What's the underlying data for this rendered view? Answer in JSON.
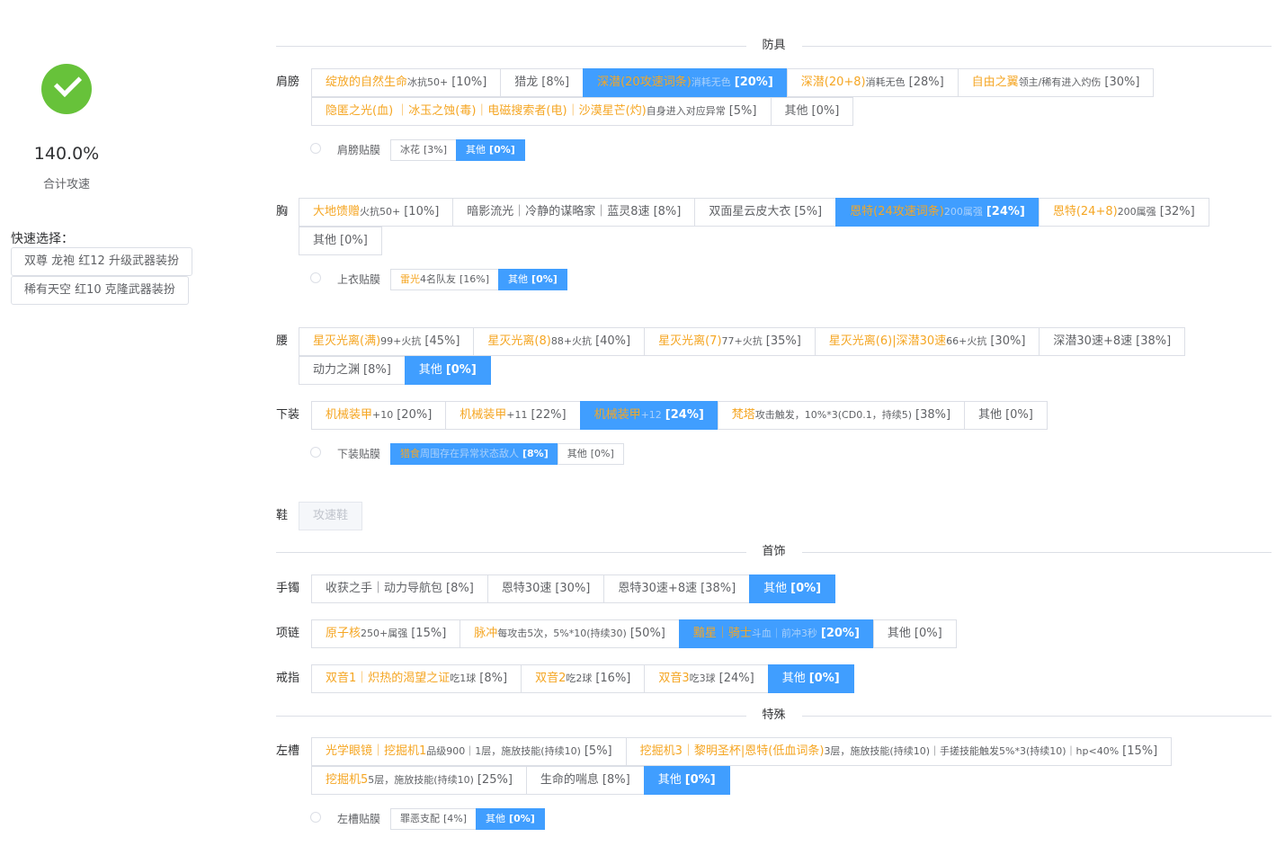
{
  "summary": {
    "total": "140.0%",
    "label": "合计攻速"
  },
  "quick": {
    "title": "快速选择：",
    "presets": [
      "双尊 龙袍 红12 升级武器装扮",
      "稀有天空 红10 克隆武器装扮"
    ]
  },
  "sections": {
    "armor": "防具",
    "accessory": "首饰",
    "special": "特殊"
  },
  "rows": {
    "shoulder": {
      "label": "肩膀",
      "options": [
        {
          "n": "绽放的自然生命",
          "d": "冰抗50+",
          "v": "[10%]"
        },
        {
          "n": "",
          "d": "",
          "t": "猎龙",
          "v": "[8%]"
        },
        {
          "n": "深潜(20攻速词条)",
          "d": "消耗无色",
          "v": "[20%]",
          "sel": true
        },
        {
          "n": "深潜(20+8)",
          "d": "消耗无色",
          "v": "[28%]"
        },
        {
          "n": "自由之翼",
          "d": "领主/稀有进入灼伤",
          "v": "[30%]"
        },
        {
          "n": "隐匿之光(血) ｜冰玉之蚀(毒)｜电磁搜索者(电)｜沙漠星芒(灼)",
          "d": "自身进入对应异常",
          "v": "[5%]"
        },
        {
          "t": "其他",
          "v": "[0%]"
        }
      ]
    },
    "shoulder_film": {
      "label": "肩膀贴膜",
      "options": [
        {
          "t": "冰花",
          "v": "[3%]"
        },
        {
          "t": "其他",
          "v": "[0%]",
          "sel": true
        }
      ]
    },
    "chest": {
      "label": "胸",
      "options": [
        {
          "n": "大地馈赠",
          "d": "火抗50+",
          "v": "[10%]"
        },
        {
          "t": "暗影流光｜冷静的谋略家｜蓝灵8速",
          "v": "[8%]"
        },
        {
          "t": "双面星云皮大衣",
          "v": "[5%]"
        },
        {
          "n": "恩特(24攻速词条)",
          "d": "200属强",
          "v": "[24%]",
          "sel": true
        },
        {
          "n": "恩特(24+8)",
          "d": "200属强",
          "v": "[32%]"
        },
        {
          "t": "其他",
          "v": "[0%]"
        }
      ]
    },
    "chest_film": {
      "label": "上衣贴膜",
      "options": [
        {
          "n": "雷光",
          "d": "4名队友",
          "v": "[16%]"
        },
        {
          "t": "其他",
          "v": "[0%]",
          "sel": true
        }
      ]
    },
    "waist": {
      "label": "腰",
      "options": [
        {
          "n": "星灭光离(满)",
          "d": "99+火抗",
          "v": "[45%]"
        },
        {
          "n": "星灭光离(8)",
          "d": "88+火抗",
          "v": "[40%]"
        },
        {
          "n": "星灭光离(7)",
          "d": "77+火抗",
          "v": "[35%]"
        },
        {
          "n": "星灭光离(6)|深潜30速",
          "d": "66+火抗",
          "v": "[30%]"
        },
        {
          "t": "深潜30速+8速",
          "v": "[38%]"
        },
        {
          "t": "动力之渊",
          "v": "[8%]"
        },
        {
          "t": "其他",
          "v": "[0%]",
          "sel": true
        }
      ]
    },
    "legs": {
      "label": "下装",
      "options": [
        {
          "n": "机械装甲",
          "d": "+10",
          "v": "[20%]"
        },
        {
          "n": "机械装甲",
          "d": "+11",
          "v": "[22%]"
        },
        {
          "n": "机械装甲",
          "d": "+12",
          "v": "[24%]",
          "sel": true
        },
        {
          "n": "梵塔",
          "d": "攻击触发，10%*3(CD0.1，持续5)",
          "v": "[38%]"
        },
        {
          "t": "其他",
          "v": "[0%]"
        }
      ]
    },
    "legs_film": {
      "label": "下装贴膜",
      "options": [
        {
          "n": "猎食",
          "d": "周围存在异常状态敌人",
          "v": "[8%]",
          "sel": true
        },
        {
          "t": "其他",
          "v": "[0%]"
        }
      ]
    },
    "shoes": {
      "label": "鞋",
      "options": [
        {
          "t": "攻速鞋",
          "dis": true
        }
      ]
    },
    "bracelet": {
      "label": "手镯",
      "options": [
        {
          "t": "收获之手｜动力导航包",
          "v": "[8%]"
        },
        {
          "t": "恩特30速",
          "v": "[30%]"
        },
        {
          "t": "恩特30速+8速",
          "v": "[38%]"
        },
        {
          "t": "其他",
          "v": "[0%]",
          "sel": true
        }
      ]
    },
    "necklace": {
      "label": "项链",
      "options": [
        {
          "n": "原子核",
          "d": "250+属强",
          "v": "[15%]"
        },
        {
          "n": "脉冲",
          "d": "每攻击5次，5%*10(持续30)",
          "v": "[50%]"
        },
        {
          "n": "黯星｜骑士",
          "d": "斗血｜前冲3秒",
          "v": "[20%]",
          "sel": true
        },
        {
          "t": "其他",
          "v": "[0%]"
        }
      ]
    },
    "ring": {
      "label": "戒指",
      "options": [
        {
          "n": "双音1｜炽热的渴望之证",
          "d": "吃1球",
          "v": "[8%]"
        },
        {
          "n": "双音2",
          "d": "吃2球",
          "v": "[16%]"
        },
        {
          "n": "双音3",
          "d": "吃3球",
          "v": "[24%]"
        },
        {
          "t": "其他",
          "v": "[0%]",
          "sel": true
        }
      ]
    },
    "left_slot": {
      "label": "左槽",
      "options": [
        {
          "n": "光学眼镜｜挖掘机1",
          "d": "品级900｜1层，施放技能(持续10)",
          "v": "[5%]"
        },
        {
          "n": "挖掘机3｜黎明圣杯|恩特(低血词条)",
          "d": "3层，施放技能(持续10)｜手搓技能触发5%*3(持续10)｜hp<40%",
          "v": "[15%]"
        },
        {
          "n": "挖掘机5",
          "d": "5层，施放技能(持续10)",
          "v": "[25%]"
        },
        {
          "t": "生命的喘息",
          "v": "[8%]"
        },
        {
          "t": "其他",
          "v": "[0%]",
          "sel": true
        }
      ]
    },
    "left_film": {
      "label": "左槽贴膜",
      "options": [
        {
          "t": "罪恶支配",
          "v": "[4%]"
        },
        {
          "t": "其他",
          "v": "[0%]",
          "sel": true
        }
      ]
    }
  },
  "colors": {
    "primary": "#409eff",
    "accent": "#f5a623",
    "success": "#67c23a"
  }
}
